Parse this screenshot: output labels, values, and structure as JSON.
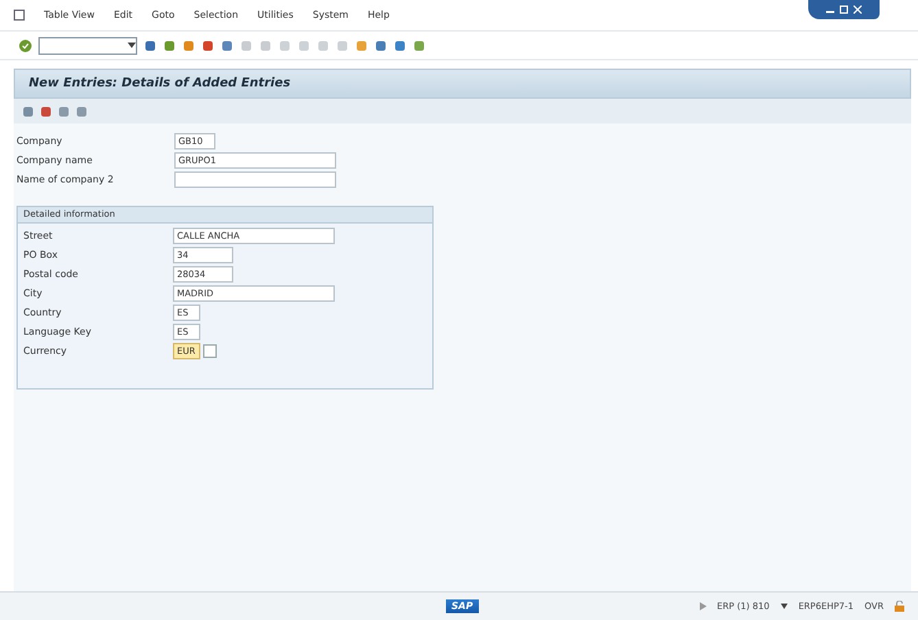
{
  "menu_bar": [
    "Table View",
    "Edit",
    "Goto",
    "Selection",
    "Utilities",
    "System",
    "Help"
  ],
  "title": "New Entries: Details of Added Entries",
  "fields": [
    {
      "label": "Company",
      "value": "GB10"
    },
    {
      "label": "Company name",
      "value": "GRUPO1"
    },
    {
      "label": "Name of company 2"
    }
  ],
  "group": {
    "title": "Detailed information",
    "fields": [
      {
        "label": "Street",
        "value": "CALLE ANCHA",
        "focused": false
      },
      {
        "label": "PO Box",
        "value": "34",
        "focused": false
      },
      {
        "label": "Postal code",
        "value": "28034",
        "focused": false
      },
      {
        "label": "City",
        "value": "MADRID",
        "focused": false
      },
      {
        "label": "Country",
        "value": "ES",
        "focused": false
      },
      {
        "label": "Language Key",
        "value": "ES",
        "focused": false
      },
      {
        "label": "Currency",
        "value": "EUR",
        "focused": true
      }
    ]
  },
  "status_bar": {
    "logo": "SAP",
    "system": "ERP (1) 810",
    "server": "ERP6EHP7-1",
    "mode": "OVR"
  }
}
